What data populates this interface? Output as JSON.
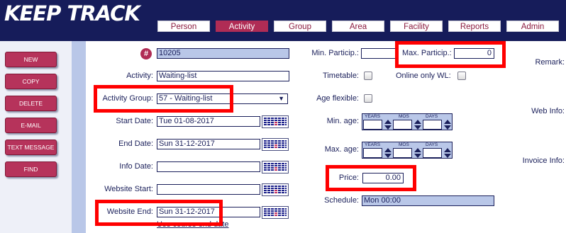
{
  "app": {
    "logo": "KEEP TRACK"
  },
  "nav": {
    "tabs": [
      {
        "label": "Person"
      },
      {
        "label": "Activity"
      },
      {
        "label": "Group"
      },
      {
        "label": "Area"
      },
      {
        "label": "Facility"
      },
      {
        "label": "Reports"
      },
      {
        "label": "Admin"
      }
    ],
    "active": "Activity"
  },
  "sidebar": {
    "buttons": [
      {
        "label": "NEW"
      },
      {
        "label": "COPY"
      },
      {
        "label": "DELETE"
      },
      {
        "label": "E-MAIL"
      },
      {
        "label": "TEXT MESSAGE"
      },
      {
        "label": "FIND"
      }
    ]
  },
  "form": {
    "id_value": "10205",
    "id_icon": "#",
    "activity_label": "Activity:",
    "activity_value": "Waiting-list",
    "group_label": "Activity Group:",
    "group_value": "57 - Waiting-list",
    "start_label": "Start Date:",
    "start_value": "Tue 01-08-2017",
    "end_label": "End Date:",
    "end_value": "Sun 31-12-2017",
    "info_label": "Info Date:",
    "info_value": "",
    "web_start_label": "Website Start:",
    "web_start_value": "",
    "web_end_label": "Website End:",
    "web_end_value": "Sun 31-12-2017",
    "course_link": "Use course end date",
    "min_label": "Min. Particip.:",
    "min_value": "",
    "max_label": "Max. Particip.:",
    "max_value": "0",
    "timetable_label": "Timetable:",
    "online_label": "Online only WL:",
    "age_flex_label": "Age flexible:",
    "min_age_label": "Min. age:",
    "max_age_label": "Max. age:",
    "age_headers": {
      "years": "YEARS",
      "mos": "MOS",
      "days": "DAYS"
    },
    "price_label": "Price:",
    "price_value": "0.00",
    "schedule_label": "Schedule:",
    "schedule_value": "Mon 00:00",
    "remark_label": "Remark:",
    "webinfo_label": "Web Info:",
    "invoice_label": "Invoice Info:"
  },
  "colors": {
    "header": "#161c5a",
    "accent": "#b02c55",
    "highlight": "#ff0000",
    "readonly": "#b9c7e8"
  }
}
